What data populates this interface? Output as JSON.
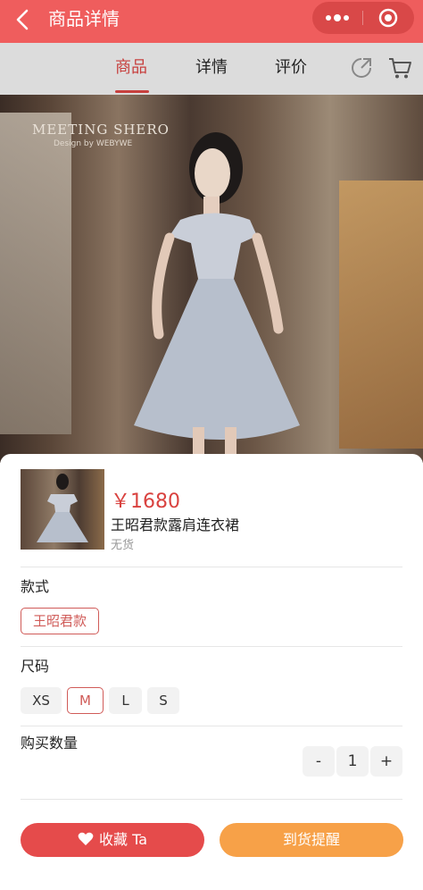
{
  "header": {
    "title": "商品详情",
    "back_icon": "chevron-left-icon",
    "more_icon": "more-dots-icon",
    "close_icon": "target-close-icon",
    "color": "#ef5d5d"
  },
  "tabs": [
    {
      "label": "商品",
      "active": true
    },
    {
      "label": "详情",
      "active": false
    },
    {
      "label": "评价",
      "active": false
    }
  ],
  "tab_icons": {
    "share": "share-icon",
    "cart": "cart-icon"
  },
  "photo": {
    "brand": "MEETING SHERO",
    "brand_sub": "Design by WEBYWE"
  },
  "sheet": {
    "price": "￥1680",
    "product_name": "王昭君款露肩连衣裙",
    "stock": "无货",
    "style_label": "款式",
    "styles": [
      {
        "label": "王昭君款",
        "selected": true
      }
    ],
    "size_label": "尺码",
    "sizes": [
      {
        "label": "XS",
        "selected": false
      },
      {
        "label": "M",
        "selected": true
      },
      {
        "label": "L",
        "selected": false
      },
      {
        "label": "S",
        "selected": false
      }
    ],
    "qty_label": "购买数量",
    "qty_minus": "-",
    "qty_value": "1",
    "qty_plus": "+",
    "fav_button": "收藏 Ta",
    "fav_icon": "heart-icon",
    "notify_button": "到货提醒",
    "accent": "#d9423f",
    "notify_color": "#f7a148"
  }
}
